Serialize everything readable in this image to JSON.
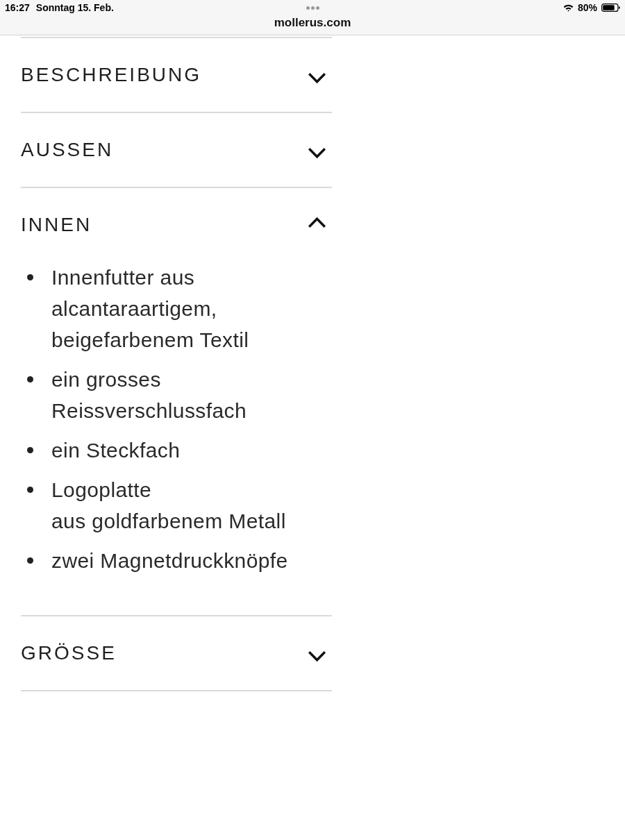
{
  "status_bar": {
    "time": "16:27",
    "date": "Sonntag 15. Feb.",
    "battery_text": "80%",
    "url": "mollerus.com"
  },
  "sections": [
    {
      "title": "BESCHREIBUNG",
      "expanded": false
    },
    {
      "title": "AUSSEN",
      "expanded": false
    },
    {
      "title": "INNEN",
      "expanded": true,
      "items": [
        "Innenfutter aus alcantaraartigem, beigefarbenem Textil",
        "ein grosses Reissverschlussfach",
        "ein Steckfach",
        "Logoplatte\naus goldfarbenem Metall",
        "zwei Magnetdruckknöpfe"
      ]
    },
    {
      "title": "GRÖSSE",
      "expanded": false
    }
  ]
}
